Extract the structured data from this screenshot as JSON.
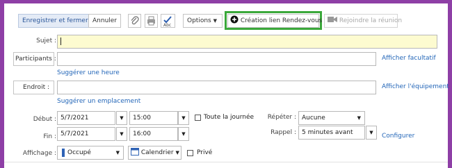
{
  "toolbar": {
    "save_close": "Enregistrer et fermer",
    "cancel": "Annuler",
    "options": "Options",
    "create_link": "Création lien Rendez-vous",
    "join_meeting": "Rejoindre la réunion"
  },
  "form": {
    "subject_label": "Sujet :",
    "subject_value": "",
    "participants_button": "Participants :",
    "show_optional": "Afficher facultatif",
    "suggest_time": "Suggérer une heure",
    "location_button": "Endroit :",
    "show_equipment": "Afficher l'équipement",
    "suggest_location": "Suggérer un emplacement",
    "start_label": "Début :",
    "start_date": "5/7/2021",
    "start_time": "15:00",
    "all_day": "Toute la journée",
    "end_label": "Fin :",
    "end_date": "5/7/2021",
    "end_time": "16:00",
    "repeat_label": "Répéter :",
    "repeat_value": "Aucune",
    "reminder_label": "Rappel :",
    "reminder_value": "5 minutes avant",
    "configure": "Configurer",
    "display_label": "Affichage :",
    "display_value": "Occupé",
    "calendar_value": "Calendrier",
    "private": "Privé"
  },
  "colors": {
    "frame": "#8e3fa6",
    "highlight": "#3aa83a",
    "link": "#2366b8",
    "subject_bg": "#fdfbd0",
    "busy": "#2f63b5"
  }
}
